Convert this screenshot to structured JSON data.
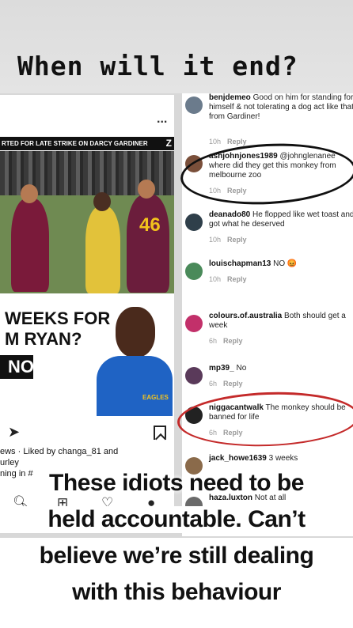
{
  "story": {
    "headline": "When will it end?",
    "caption_lines": [
      "These idiots need to be",
      "held accountable.  Can’t",
      "believe we’re still dealing",
      "with this behaviour"
    ]
  },
  "post": {
    "more": "...",
    "banner": "RTED FOR LATE STRIKE ON DARCY GARDINER",
    "jersey_number": "46",
    "promo_line1": "WEEKS FOR",
    "promo_line2": "M RYAN?",
    "promo_box": "NO",
    "eagles_logo": "EAGLES",
    "likes_line1": "ews · Liked by changa_81 and",
    "likes_line2": "urley",
    "likes_line3": "ning in #",
    "icons": [
      "send-icon",
      "bookmark-icon",
      "search-icon",
      "add-icon",
      "heart-icon",
      "profile-icon"
    ]
  },
  "comments": [
    {
      "user": "benjdemeo",
      "text": "Good on him for standing for himself & not tolerating a dog act like that from Gardiner!",
      "time": "10h",
      "reply": "Reply",
      "color": "#6b7b8c"
    },
    {
      "user": "ashjohnjones1989",
      "text": "@johnglenanee where did they get this monkey from melbourne zoo",
      "time": "10h",
      "reply": "Reply",
      "color": "#7a4f3a"
    },
    {
      "user": "deanado80",
      "text": "He flopped like wet toast and got what he deserved",
      "time": "10h",
      "reply": "Reply",
      "color": "#2f3f4a"
    },
    {
      "user": "louischapman13",
      "text": "NO 😡",
      "time": "10h",
      "reply": "Reply",
      "color": "#4a8a5a"
    },
    {
      "user": "colours.of.australia",
      "text": "Both should get a week",
      "time": "6h",
      "reply": "Reply",
      "color": "#c2306a"
    },
    {
      "user": "mp39_",
      "text": "No",
      "time": "6h",
      "reply": "Reply",
      "color": "#5a3a5a"
    },
    {
      "user": "niggacantwalk",
      "text": "The monkey should be banned for life",
      "time": "6h",
      "reply": "Reply",
      "color": "#222222"
    },
    {
      "user": "jack_howe1639",
      "text": "3 weeks",
      "time": "",
      "reply": "",
      "color": "#8a6a4a"
    },
    {
      "user": "haza.luxton",
      "text": "Not at all",
      "time": "",
      "reply": "",
      "color": "#6a6a6a"
    }
  ]
}
